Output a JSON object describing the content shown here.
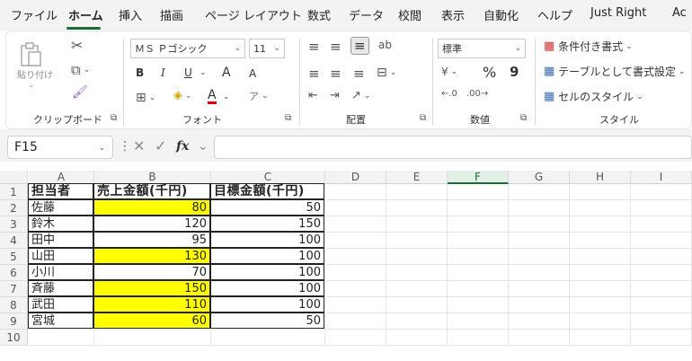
{
  "menu": {
    "items": [
      "ファイル",
      "ホーム",
      "挿入",
      "描画",
      "ページ レイアウト",
      "数式",
      "データ",
      "校閲",
      "表示",
      "自動化",
      "ヘルプ",
      "Just Right",
      "Ac"
    ]
  },
  "ribbon": {
    "clipboard": {
      "paste_label": "貼り付け",
      "group_label": "クリップボード"
    },
    "font": {
      "font_name": "ＭＳ Ｐゴシック",
      "font_size": "11",
      "bold": "B",
      "italic": "I",
      "underline": "U",
      "grow": "A",
      "shrink": "A",
      "font_color": "A",
      "group_label": "フォント"
    },
    "alignment": {
      "group_label": "配置"
    },
    "number": {
      "format": "標準",
      "percent": "%",
      "comma": "9",
      "group_label": "数値"
    },
    "styles": {
      "conditional": "条件付き書式",
      "table": "テーブルとして書式設定",
      "cell_styles": "セルのスタイル",
      "group_label": "スタイル"
    }
  },
  "formula_bar": {
    "name_box": "F15",
    "fx": "fx",
    "formula": ""
  },
  "sheet": {
    "columns": [
      "A",
      "B",
      "C",
      "D",
      "E",
      "F",
      "G",
      "H",
      "I"
    ],
    "rows": [
      "1",
      "2",
      "3",
      "4",
      "5",
      "6",
      "7",
      "8",
      "9",
      "10"
    ],
    "headers": [
      "担当者",
      "売上金額(千円)",
      "目標金額(千円)"
    ],
    "data": [
      {
        "name": "佐藤",
        "sales": "80",
        "target": "50",
        "highlight": true
      },
      {
        "name": "鈴木",
        "sales": "120",
        "target": "150",
        "highlight": false
      },
      {
        "name": "田中",
        "sales": "95",
        "target": "100",
        "highlight": false
      },
      {
        "name": "山田",
        "sales": "130",
        "target": "100",
        "highlight": true
      },
      {
        "name": "小川",
        "sales": "70",
        "target": "100",
        "highlight": false
      },
      {
        "name": "斉藤",
        "sales": "150",
        "target": "100",
        "highlight": true
      },
      {
        "name": "武田",
        "sales": "110",
        "target": "100",
        "highlight": true
      },
      {
        "name": "宮城",
        "sales": "60",
        "target": "50",
        "highlight": true
      }
    ],
    "highlight_color": "#ffff00",
    "active_column": "F"
  }
}
